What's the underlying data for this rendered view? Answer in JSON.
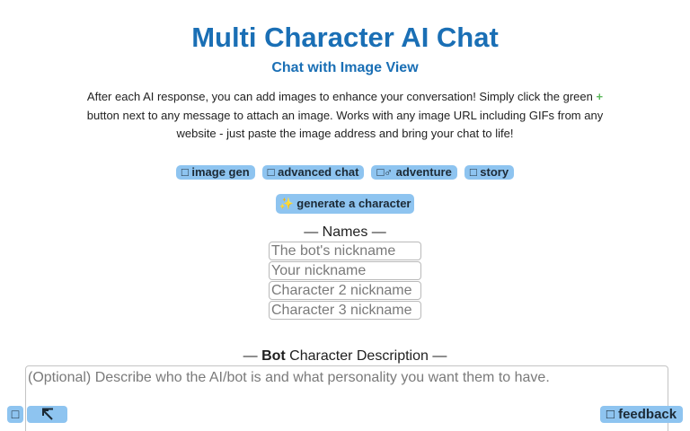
{
  "header": {
    "title": "Multi Character AI Chat",
    "subtitle": "Chat with Image View"
  },
  "intro": {
    "before_plus": "After each AI response, you can add images to enhance your conversation! Simply click the green",
    "plus_symbol": "+",
    "after_plus": "button next to any message to attach an image. Works with any image URL including GIFs from any website - just paste the image address and bring your chat to life!"
  },
  "tags": [
    {
      "label": "□ image gen",
      "icon": "image-icon"
    },
    {
      "label": "□ advanced chat",
      "icon": "chat-icon"
    },
    {
      "label": "□♂ adventure",
      "icon": "adventure-icon"
    },
    {
      "label": "□ story",
      "icon": "book-icon"
    }
  ],
  "generate_button": {
    "label": "✨ generate a character"
  },
  "names": {
    "heading": "— Names —",
    "bot_placeholder": "The bot's nickname",
    "user_placeholder": "Your nickname",
    "char2_placeholder": "Character 2 nickname",
    "char3_placeholder": "Character 3 nickname"
  },
  "bot_description": {
    "heading_prefix": "— ",
    "heading_bold": "Bot",
    "heading_suffix": " Character Description —",
    "placeholder": "(Optional) Describe who the AI/bot is and what personality you want them to have."
  },
  "footer": {
    "left_small_label": "□",
    "feedback_label": "□ feedback",
    "arrow_icon": "arrow-up-left-icon"
  },
  "colors": {
    "title": "#1a6fb5",
    "pill_bg": "#8ec4f0",
    "plus_green": "#5cb85c"
  }
}
